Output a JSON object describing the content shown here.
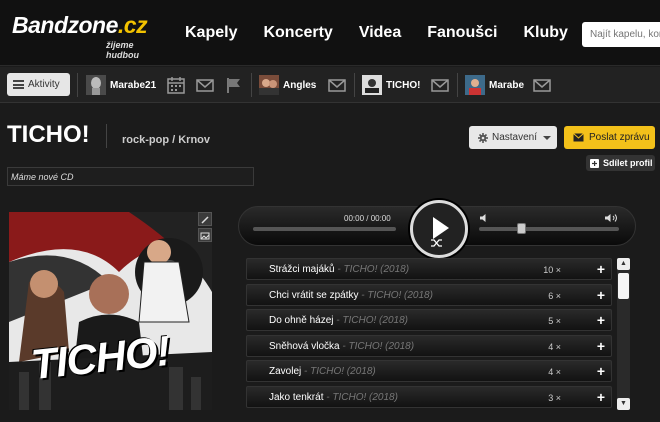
{
  "header": {
    "logo_main_a": "Bandzone",
    "logo_main_b": ".cz",
    "logo_sub": "žijeme hudbou",
    "nav": [
      "Kapely",
      "Koncerty",
      "Videa",
      "Fanoušci",
      "Kluby"
    ],
    "search_placeholder": "Najít kapelu, koncert"
  },
  "subbar": {
    "activity_label": "Aktivity",
    "users": [
      "Marabe21",
      "Angles",
      "TICHO!",
      "Marabe"
    ]
  },
  "band": {
    "name": "TICHO!",
    "genre": "rock-pop / Krnov",
    "status": "Máme nové CD",
    "settings_label": "Nastavení",
    "message_label": "Poslat zprávu",
    "share_label": "Sdílet profil",
    "cover_text": "TICHO!"
  },
  "player": {
    "time": "00:00 / 00:00"
  },
  "tracks": [
    {
      "title": "Strážci majáků",
      "meta": "TICHO! (2018)",
      "plays": "10 ×"
    },
    {
      "title": "Chci vrátit se zpátky",
      "meta": "TICHO! (2018)",
      "plays": "6 ×"
    },
    {
      "title": "Do ohně házej",
      "meta": "TICHO! (2018)",
      "plays": "5 ×"
    },
    {
      "title": "Sněhová vločka",
      "meta": "TICHO! (2018)",
      "plays": "4 ×"
    },
    {
      "title": "Zavolej",
      "meta": "TICHO! (2018)",
      "plays": "4 ×"
    },
    {
      "title": "Jako tenkrát",
      "meta": "TICHO! (2018)",
      "plays": "3 ×"
    }
  ],
  "track_separator": " - ",
  "track_add_glyph": "+",
  "colors": {
    "accent": "#f2c200",
    "background": "#1b1b1b",
    "message_button": "#f3c11a"
  }
}
